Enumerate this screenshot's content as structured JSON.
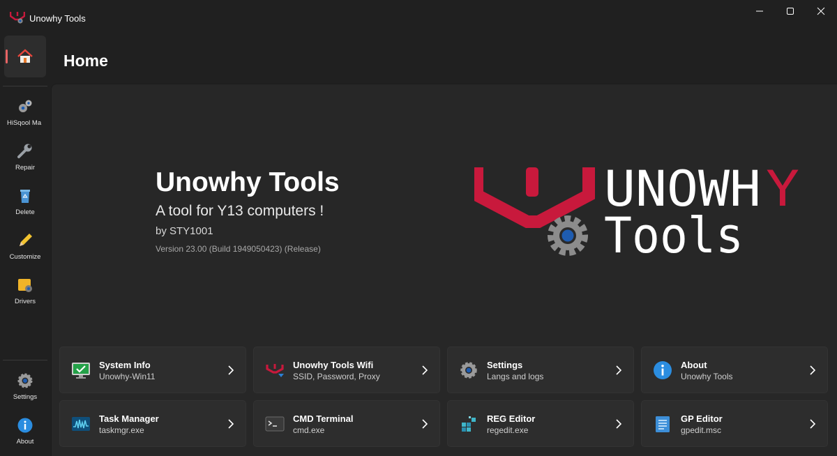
{
  "app": {
    "title": "Unowhy Tools"
  },
  "header": {
    "title": "Home"
  },
  "sidebar": {
    "items": [
      {
        "label": "HiSqool Ma",
        "icon": "gears-icon"
      },
      {
        "label": "Repair",
        "icon": "wrench-icon"
      },
      {
        "label": "Delete",
        "icon": "recycle-bin-icon"
      },
      {
        "label": "Customize",
        "icon": "pencil-icon"
      },
      {
        "label": "Drivers",
        "icon": "drivers-icon"
      }
    ],
    "footer": [
      {
        "label": "Settings",
        "icon": "gear-icon"
      },
      {
        "label": "About",
        "icon": "info-icon"
      }
    ]
  },
  "hero": {
    "title": "Unowhy Tools",
    "subtitle": "A tool for Y13 computers !",
    "author": "by STY1001",
    "version": "Version 23.00 (Build 1949050423) (Release)"
  },
  "brand": {
    "line1": "UNOWHY",
    "line2": "Tools"
  },
  "cards": [
    {
      "title": "System Info",
      "subtitle": "Unowhy-Win11",
      "icon": "monitor-check-icon"
    },
    {
      "title": "Unowhy Tools Wifi",
      "subtitle": "SSID, Password, Proxy",
      "icon": "wifi-logo-icon"
    },
    {
      "title": "Settings",
      "subtitle": "Langs and logs",
      "icon": "gear-icon"
    },
    {
      "title": "About",
      "subtitle": "Unowhy Tools",
      "icon": "info-icon"
    },
    {
      "title": "Task Manager",
      "subtitle": "taskmgr.exe",
      "icon": "task-manager-icon"
    },
    {
      "title": "CMD Terminal",
      "subtitle": "cmd.exe",
      "icon": "terminal-icon"
    },
    {
      "title": "REG Editor",
      "subtitle": "regedit.exe",
      "icon": "registry-icon"
    },
    {
      "title": "GP Editor",
      "subtitle": "gpedit.msc",
      "icon": "policy-document-icon"
    }
  ],
  "colors": {
    "accent": "#e86464",
    "brand_red": "#c8193c",
    "background": "#202020",
    "panel": "#272727",
    "card": "#2d2d2d"
  }
}
